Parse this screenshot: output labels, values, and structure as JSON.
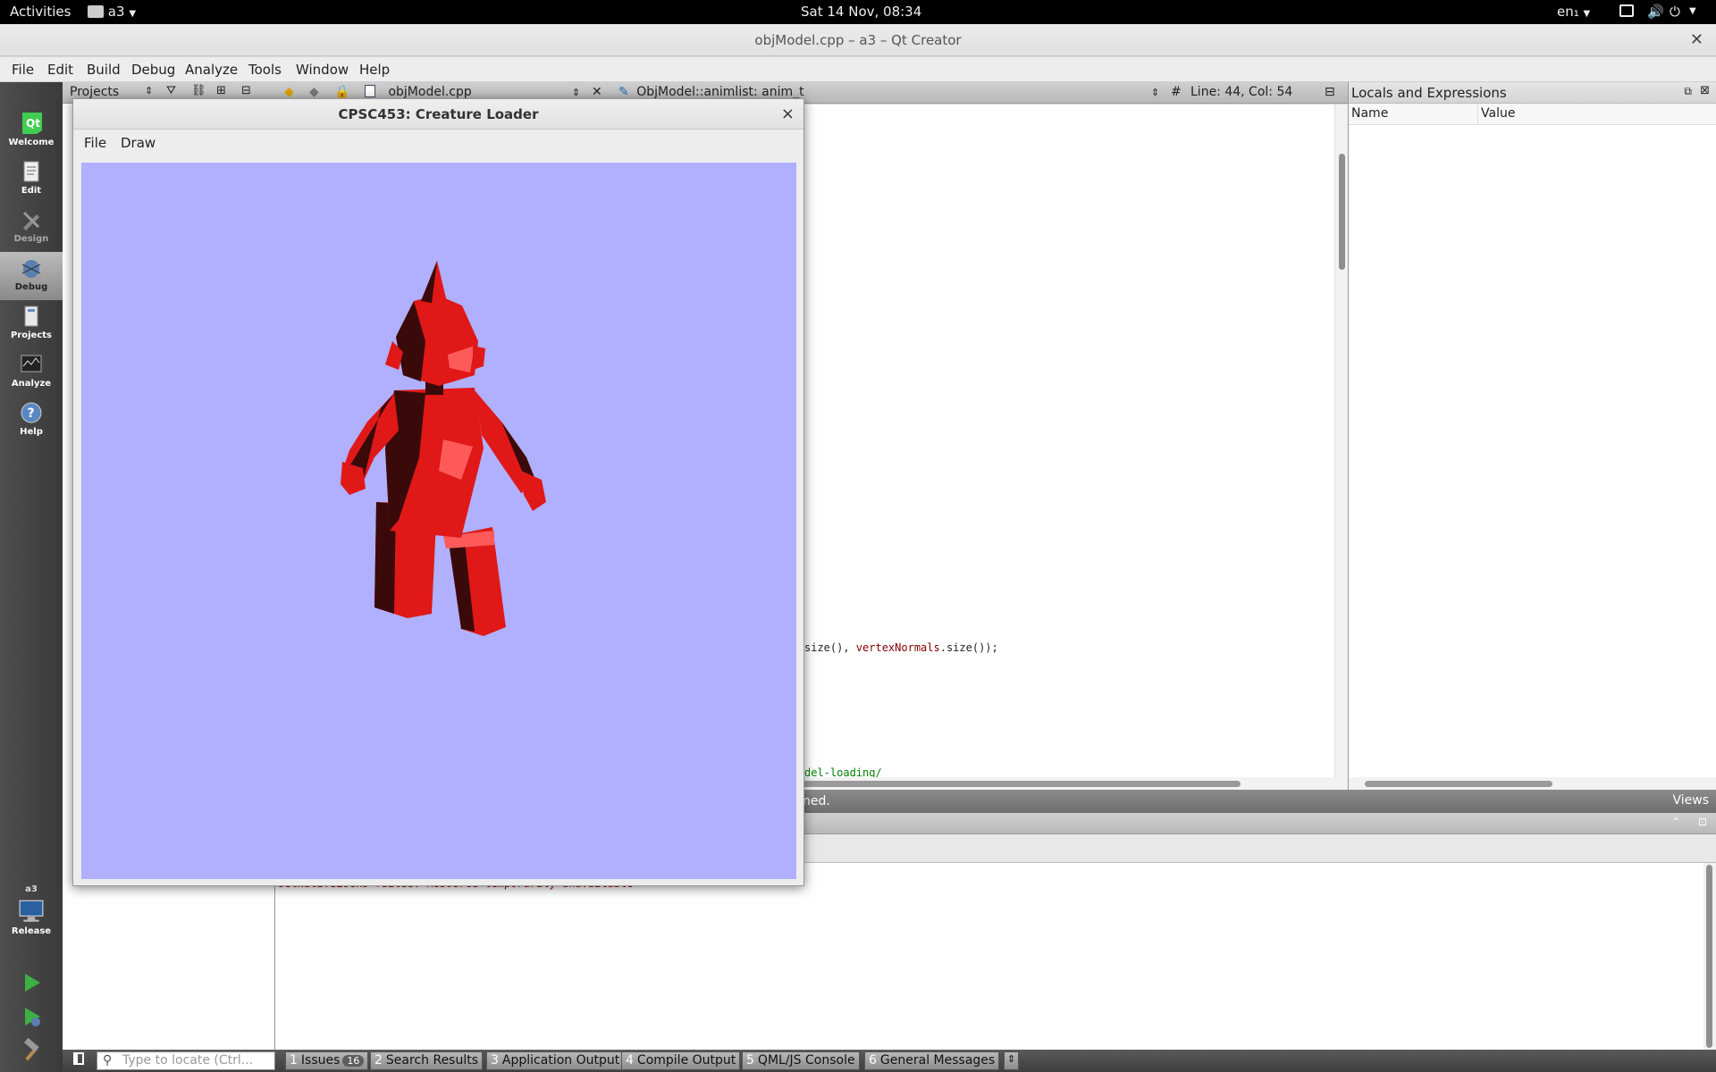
{
  "topbar": {
    "activities": "Activities",
    "app_menu": "a3",
    "clock": "Sat 14 Nov, 08:34",
    "keyboard": "en₁"
  },
  "window": {
    "title": "objModel.cpp – a3 – Qt Creator"
  },
  "menu": [
    "File",
    "Edit",
    "Build",
    "Debug",
    "Analyze",
    "Tools",
    "Window",
    "Help"
  ],
  "modes": [
    "Welcome",
    "Edit",
    "Design",
    "Debug",
    "Projects",
    "Analyze",
    "Help"
  ],
  "kit": {
    "project": "a3",
    "build": "Release"
  },
  "left_pane": {
    "header": "Projects"
  },
  "editor_toolbar": {
    "file": "objModel.cpp",
    "symbol": "ObjModel::animlist: anim_t",
    "position": "Line: 44, Col: 54"
  },
  "editor": {
    "line1_plain_a": "size(), ",
    "line1_ident": "vertexNormals",
    "line1_plain_b": ".size());",
    "line2": "del-loading/"
  },
  "locals": {
    "title": "Locals and Expressions",
    "col_name": "Name",
    "col_value": "Value"
  },
  "debug_status": {
    "text": "ned.",
    "views": "Views"
  },
  "output": {
    "message": "setNativeLocks failed: Resource temporarily unavailable"
  },
  "bottombar": {
    "locate_placeholder": "Type to locate (Ctrl...",
    "tabs": [
      {
        "num": "1",
        "label": "Issues",
        "badge": "16"
      },
      {
        "num": "2",
        "label": "Search Results"
      },
      {
        "num": "3",
        "label": "Application Output"
      },
      {
        "num": "4",
        "label": "Compile Output"
      },
      {
        "num": "5",
        "label": "QML/JS Console"
      },
      {
        "num": "6",
        "label": "General Messages"
      }
    ]
  },
  "app_window": {
    "title": "CPSC453: Creature Loader",
    "menu": [
      "File",
      "Draw"
    ],
    "colors": {
      "background": "#b0b0ff",
      "model": "#e01818"
    }
  }
}
